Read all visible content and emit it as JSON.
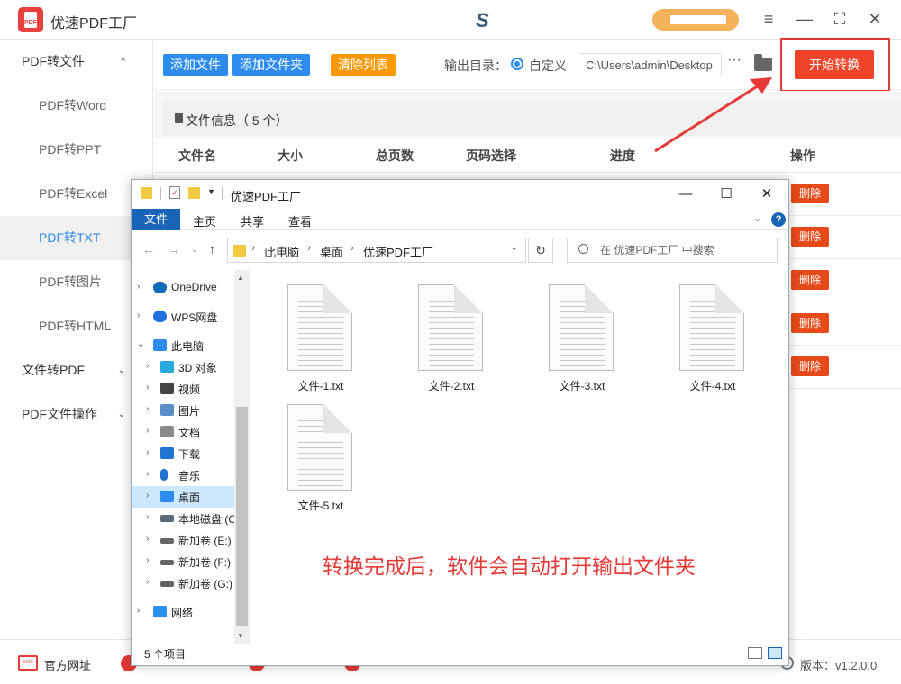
{
  "app": {
    "logo_text": "PDF",
    "title": "优速PDF工厂"
  },
  "window_controls": {
    "menu": "≡",
    "minimize": "—",
    "maximize": "⛶",
    "close": "✕"
  },
  "sidebar": {
    "groups": [
      {
        "label": "PDF转文件",
        "chevron": "^",
        "items": [
          "PDF转Word",
          "PDF转PPT",
          "PDF转Excel",
          "PDF转TXT",
          "PDF转图片",
          "PDF转HTML"
        ],
        "active_item": "PDF转TXT"
      },
      {
        "label": "文件转PDF",
        "chevron": "⌄"
      },
      {
        "label": "PDF文件操作",
        "chevron": "⌄"
      }
    ]
  },
  "toolbar": {
    "add_file": "添加文件",
    "add_folder": "添加文件夹",
    "clear_list": "清除列表",
    "output_dir_label": "输出目录：",
    "custom_label": "自定义",
    "path_value": "C:\\Users\\admin\\Desktop",
    "more": "···",
    "start": "开始转换"
  },
  "file_list": {
    "info_label": "文件信息（ 5 个）",
    "columns": [
      "文件名",
      "大小",
      "总页数",
      "页码选择",
      "进度",
      "操作"
    ],
    "delete_label": "删除",
    "row_count": 5
  },
  "footer": {
    "web_icon_text": "com",
    "official_site": "官方网址",
    "version": "版本：v1.2.0.0"
  },
  "explorer": {
    "title": "优速PDF工厂",
    "ribbon_tabs": [
      "文件",
      "主页",
      "共享",
      "查看"
    ],
    "help": "?",
    "breadcrumb": [
      "此电脑",
      "桌面",
      "优速PDF工厂"
    ],
    "search_placeholder": "在 优速PDF工厂 中搜索",
    "tree": [
      {
        "label": "OneDrive",
        "icon": "cloud-icon",
        "color": "#0f6cbd"
      },
      {
        "label": "WPS网盘",
        "icon": "wps-cloud-icon",
        "color": "#1e6fd9"
      },
      {
        "label": "此电脑",
        "icon": "computer-icon",
        "color": "#2d8cf0"
      },
      {
        "label": "3D 对象",
        "icon": "cube-icon",
        "color": "#29a8e0"
      },
      {
        "label": "视频",
        "icon": "video-icon",
        "color": "#444444"
      },
      {
        "label": "图片",
        "icon": "pictures-icon",
        "color": "#5b8fc7"
      },
      {
        "label": "文档",
        "icon": "documents-icon",
        "color": "#8a8a8a"
      },
      {
        "label": "下载",
        "icon": "download-icon",
        "color": "#1f73d1"
      },
      {
        "label": "音乐",
        "icon": "music-icon",
        "color": "#1f73d1"
      },
      {
        "label": "桌面",
        "icon": "desktop-icon",
        "color": "#2d8cf0",
        "selected": true
      },
      {
        "label": "本地磁盘 (C:)",
        "icon": "disk-icon",
        "color": "#5a6b7a"
      },
      {
        "label": "新加卷 (E:)",
        "icon": "drive-icon",
        "color": "#666666"
      },
      {
        "label": "新加卷 (F:)",
        "icon": "drive-icon",
        "color": "#666666"
      },
      {
        "label": "新加卷 (G:)",
        "icon": "drive-icon",
        "color": "#666666"
      },
      {
        "label": "网络",
        "icon": "network-icon",
        "color": "#2d8cf0"
      }
    ],
    "files": [
      "文件-1.txt",
      "文件-2.txt",
      "文件-3.txt",
      "文件-4.txt",
      "文件-5.txt"
    ],
    "note": "转换完成后，软件会自动打开输出文件夹",
    "status": "5 个项目"
  },
  "colors": {
    "primary_blue": "#2d8cf0",
    "orange": "#ff9900",
    "start_red": "#f0442a",
    "annotation_red": "#e53935"
  }
}
